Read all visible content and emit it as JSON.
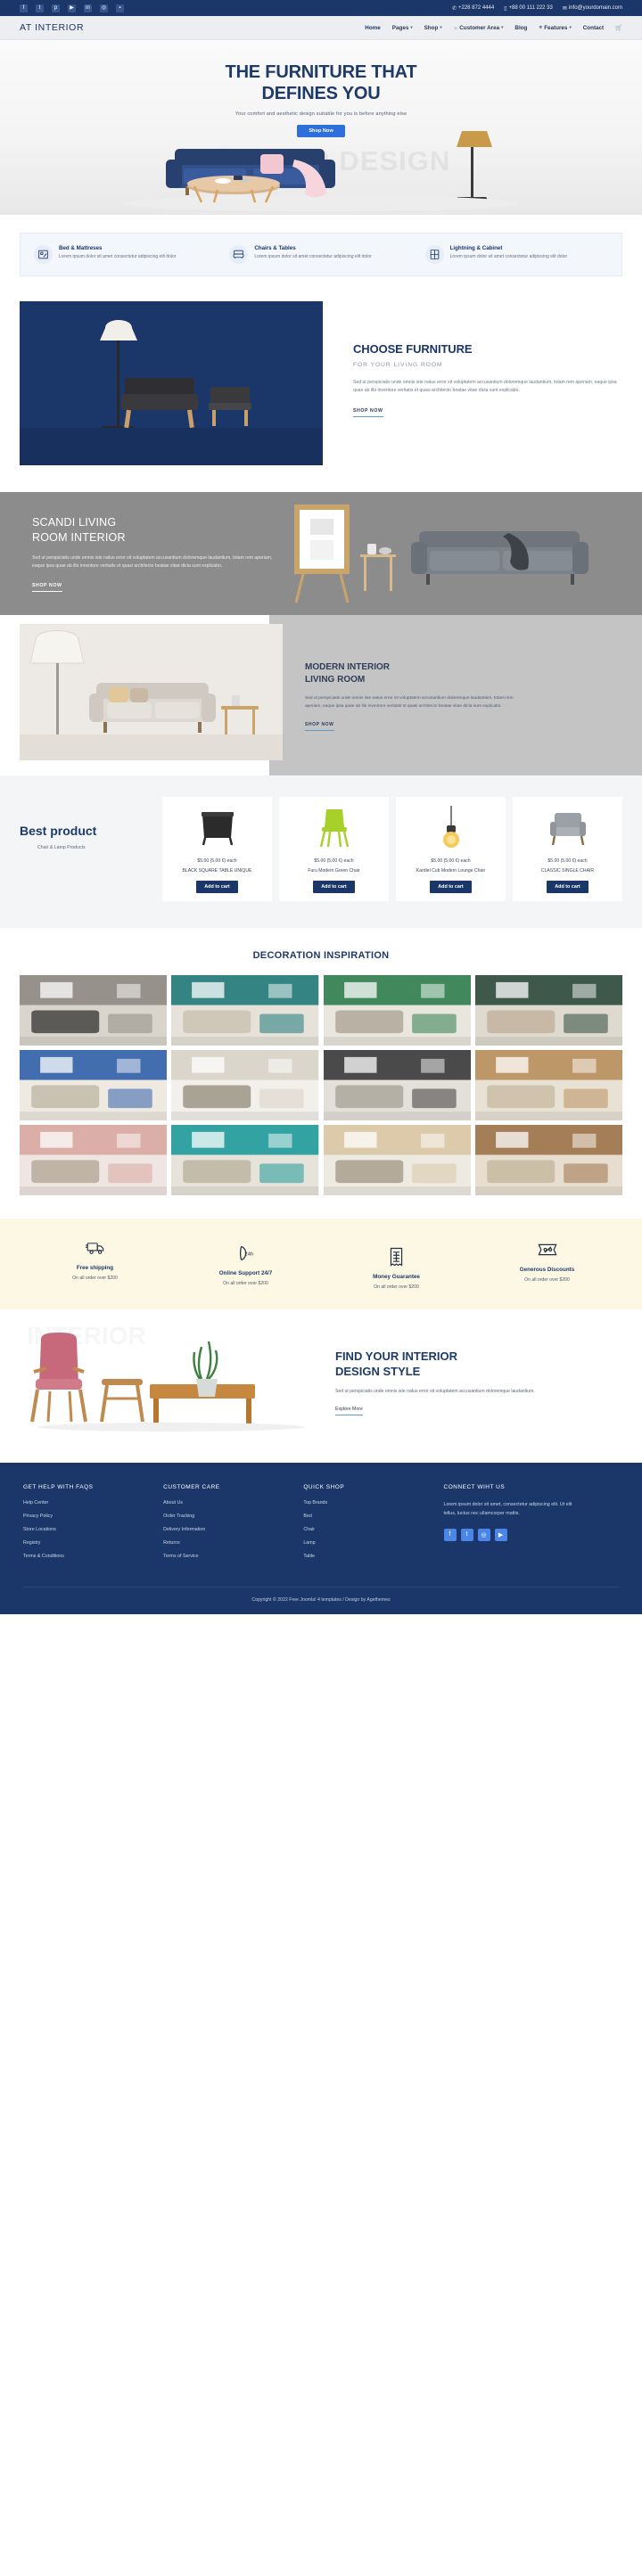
{
  "topbar": {
    "socials": [
      "facebook-icon",
      "twitter-icon",
      "pinterest-icon",
      "youtube-icon",
      "linkedin-icon",
      "instagram-icon",
      "flickr-icon"
    ],
    "phone": "+228 872 4444",
    "mobile": "+88 00 111 222 33",
    "email": "info@yourdomain.com"
  },
  "nav": {
    "brand": "AT INTERIOR",
    "items": [
      {
        "label": "Home",
        "caret": false,
        "icon": ""
      },
      {
        "label": "Pages",
        "caret": true,
        "icon": ""
      },
      {
        "label": "Shop",
        "caret": true,
        "icon": ""
      },
      {
        "label": "Customer Area",
        "caret": true,
        "icon": "user-icon"
      },
      {
        "label": "Blog",
        "caret": false,
        "icon": ""
      },
      {
        "label": "Features",
        "caret": true,
        "icon": "gear-icon"
      },
      {
        "label": "Contact",
        "caret": false,
        "icon": ""
      }
    ],
    "cart": "cart-icon"
  },
  "hero": {
    "ghost": "INTERIOR DESIGN",
    "title_line1": "THE FURNITURE THAT",
    "title_line2": "DEFINES YOU",
    "subtitle": "Your comfort and aesthetic design suitable for you is before anything else",
    "button": "Shop Now"
  },
  "features": [
    {
      "icon": "blueprint-icon",
      "title": "Bed & Mattreses",
      "desc": "Lorem ipsum dolor sit amet consectetur adipiscing elit dolor"
    },
    {
      "icon": "sofa-icon",
      "title": "Chairs & Tables",
      "desc": "Lorem ipsum dolor sit amet consectetur adipiscing elit dolor"
    },
    {
      "icon": "cabinet-icon",
      "title": "Lightning & Cabinet",
      "desc": "Lorem ipsum dolor sit amet consectetur adipiscing elit dolor"
    }
  ],
  "choose": {
    "heading": "CHOOSE FURNITURE",
    "kicker": "FOR YOUR LIVING ROOM",
    "paragraph": "Sed ut perspiciatis unde omnis iste natus error sit voluptatem accusantium doloremque laudantium, totam rem aperiam, eaque ipsa quae ab illo inventore veritatis et quasi architecto beatae vitae dicta sunt explicabo.",
    "link": "SHOP NOW"
  },
  "scandi": {
    "heading_line1": "SCANDI LIVING",
    "heading_line2": "ROOM INTERIOR",
    "paragraph": "Sed ut perspiciatis unde omnis iste natus error sit voluptatem accusantium doloremque laudantium, totam rem aperiam, eaque ipsa quae ab illo inventore veritatis et quasi architecto beatae vitae dicta sunt explicabo.",
    "link": "SHOP NOW"
  },
  "modern": {
    "heading_line1": "MODERN INTERIOR",
    "heading_line2": "LIVING ROOM",
    "paragraph": "Sed ut perspiciatis unde omnis iste natus error sit voluptatem accusantium doloremque laudantium, totam rem aperiam, eaque ipsa quae ab illo inventore veritatis et quasi architecto beatae vitae dicta sunt explicabo.",
    "link": "SHOP NOW"
  },
  "best": {
    "heading": "Best product",
    "subtitle": "Chair & Lamp Products",
    "products": [
      {
        "price": "$5.00 (5,00 €) each",
        "name": "BLACK SQUARE TABLE UNIQUE",
        "button": "Add to cart",
        "thumb": "black-table"
      },
      {
        "price": "$5.00 (5,00 €) each",
        "name": "Furu Modern Green Chair",
        "button": "Add to cart",
        "thumb": "green-chair"
      },
      {
        "price": "$5.00 (5,00 €) each",
        "name": "Kardiel Cub Modern Lounge Chair",
        "button": "Add to cart",
        "thumb": "pendant-lamp"
      },
      {
        "price": "$5.00 (5,00 €) each",
        "name": "CLASSIC SINGLE CHAIR",
        "button": "Add to cart",
        "thumb": "grey-armchair"
      }
    ]
  },
  "decoration": {
    "heading": "DECORATION INSPIRATION",
    "cells": [
      {
        "name": "living-room-grey-sofa",
        "c1": "#d9d5cd",
        "c2": "#8e8a83",
        "c3": "#5c5a57"
      },
      {
        "name": "teal-shelf-room",
        "c1": "#e6e2da",
        "c2": "#1f7a78",
        "c3": "#cfc7b8"
      },
      {
        "name": "green-leaf-art-dining",
        "c1": "#e9e6de",
        "c2": "#2f7d4f",
        "c3": "#b9b2a4"
      },
      {
        "name": "dark-green-wall-sofa",
        "c1": "#dedacf",
        "c2": "#2c4a3c",
        "c3": "#c7b9a5"
      },
      {
        "name": "blue-number-six-dining",
        "c1": "#eeeae1",
        "c2": "#2f5fa8",
        "c3": "#c9c2b2"
      },
      {
        "name": "white-bright-kitchen",
        "c1": "#f2f0ea",
        "c2": "#d8d3c8",
        "c3": "#a9a396"
      },
      {
        "name": "monochrome-bedroom",
        "c1": "#e3e0d9",
        "c2": "#3a3a3a",
        "c3": "#b5b0a5"
      },
      {
        "name": "cardboard-box-room",
        "c1": "#e8e2d4",
        "c2": "#b98f5c",
        "c3": "#cfc3ad"
      },
      {
        "name": "pink-wall-dining",
        "c1": "#efe5e2",
        "c2": "#d8a7a1",
        "c3": "#bfb4a6"
      },
      {
        "name": "turquoise-sideboard",
        "c1": "#e6e3da",
        "c2": "#1e9b9b",
        "c3": "#c4bcab"
      },
      {
        "name": "pastel-wood-chair",
        "c1": "#edeae2",
        "c2": "#d9c7a5",
        "c3": "#b3aa9a"
      },
      {
        "name": "wood-panel-bedroom",
        "c1": "#e7ded0",
        "c2": "#9c7349",
        "c3": "#cbbfa8"
      }
    ]
  },
  "benefits": [
    {
      "icon": "truck-icon",
      "title": "Free shipping",
      "desc": "On all order over $200"
    },
    {
      "icon": "support-24h-icon",
      "title": "Online Support 24/7",
      "desc": "On all order over $200"
    },
    {
      "icon": "receipt-icon",
      "title": "Money Guarantee",
      "desc": "On all order over $200"
    },
    {
      "icon": "discount-tag-icon",
      "title": "Generous Discounts",
      "desc": "On all order over $200"
    }
  ],
  "find": {
    "ghost": "INTERIOR",
    "heading_line1": "FIND YOUR INTERIOR",
    "heading_line2": "DESIGN STYLE",
    "paragraph": "Sed ut perspiciatis unde omnis iste natus error sit voluptatem accusantium doloremque laudantium.",
    "link": "Explore More"
  },
  "footer": {
    "columns": [
      {
        "title": "GET HELP WITH FAQS",
        "links": [
          "Help Center",
          "Privacy Policy",
          "Store Locations",
          "Registry",
          "Terms & Conditions"
        ]
      },
      {
        "title": "CUSTOMER CARE",
        "links": [
          "About Us",
          "Order Tracking",
          "Delivery Information",
          "Returns",
          "Terms of Service"
        ]
      },
      {
        "title": "QUICK SHOP",
        "links": [
          "Top Brands",
          "Bed",
          "Chair",
          "Lamp",
          "Table"
        ]
      }
    ],
    "connect": {
      "title": "CONNECT WIHT US",
      "text": "Lorem ipsum dolor sit amet, consectetur adipiscing elit. Ut elit tellus, luctus nec ullamcorper mattis.",
      "socials": [
        "facebook-icon",
        "twitter-icon",
        "instagram-icon",
        "youtube-icon"
      ]
    },
    "copyright": "Copyright © 2022 Free Joomla! 4 templates / Design by Agethemes"
  },
  "colors": {
    "navy": "#1b3668",
    "accent_blue": "#2d6fdb",
    "cream": "#fdf8e3",
    "grey": "#8c8c8c"
  }
}
